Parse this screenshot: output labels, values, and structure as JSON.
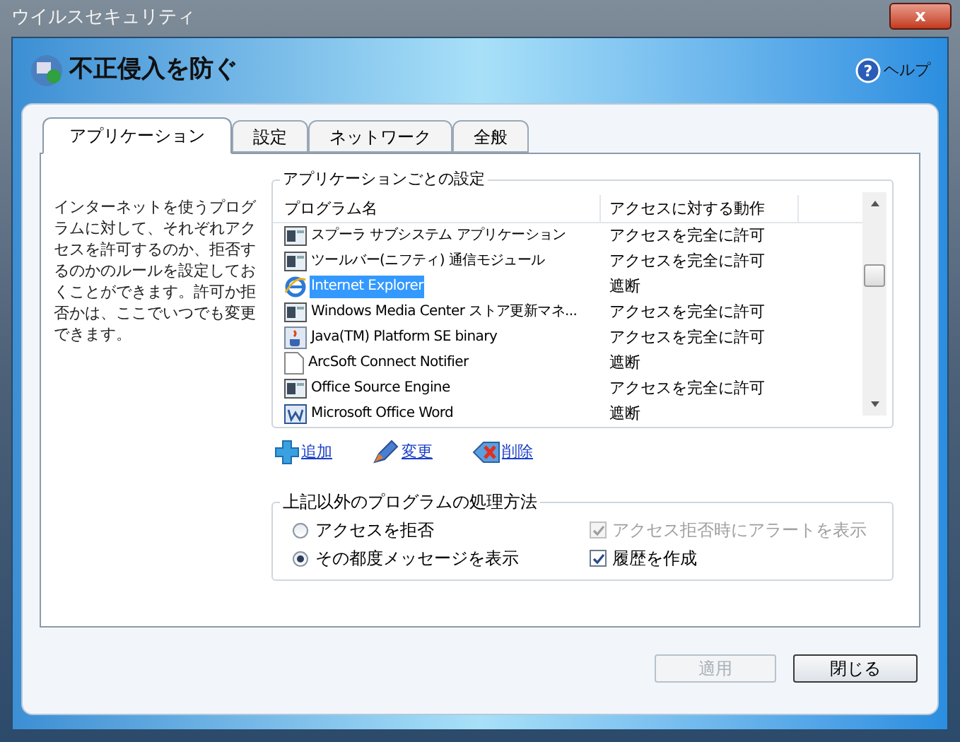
{
  "window": {
    "title": "ウイルスセキュリティ",
    "close": "x"
  },
  "header": {
    "title": "不正侵入を防ぐ",
    "help_icon": "?",
    "help": "ヘルプ"
  },
  "tabs": [
    {
      "label": "アプリケーション",
      "selected": true
    },
    {
      "label": "設定",
      "selected": false
    },
    {
      "label": "ネットワーク",
      "selected": false
    },
    {
      "label": "全般",
      "selected": false
    }
  ],
  "description": "インターネットを使うプログラムに対して、それぞれアクセスを許可するのか、拒否するのかのルールを設定しておくことができます。許可か拒否かは、ここでいつでも変更できます。",
  "app_group": {
    "title": "アプリケーションごとの設定",
    "columns": [
      "プログラム名",
      "アクセスに対する動作"
    ],
    "rows": [
      {
        "kind": "app",
        "name": "スプーラ サブシステム アプリケーション",
        "action": "アクセスを完全に許可",
        "selected": false
      },
      {
        "kind": "app",
        "name": "ツールバー(ニフティ) 通信モジュール",
        "action": "アクセスを完全に許可",
        "selected": false
      },
      {
        "kind": "browser",
        "name": "Internet Explorer",
        "action": "遮断",
        "selected": true
      },
      {
        "kind": "app",
        "name": "Windows Media Center ストア更新マネ...",
        "action": "アクセスを完全に許可",
        "selected": false
      },
      {
        "kind": "java",
        "name": "Java(TM) Platform SE binary",
        "action": "アクセスを完全に許可",
        "selected": false
      },
      {
        "kind": "blank",
        "name": "ArcSoft Connect Notifier",
        "action": "遮断",
        "selected": false
      },
      {
        "kind": "app",
        "name": "Office Source Engine",
        "action": "アクセスを完全に許可",
        "selected": false
      },
      {
        "kind": "word",
        "name": "Microsoft Office Word",
        "action": "遮断",
        "selected": false
      }
    ]
  },
  "links": [
    {
      "kind": "add",
      "label": "追加"
    },
    {
      "kind": "edit",
      "label": "変更"
    },
    {
      "kind": "delete",
      "label": "削除"
    }
  ],
  "other_group": {
    "title": "上記以外のプログラムの処理方法",
    "radios": [
      {
        "label": "アクセスを拒否",
        "selected": false
      },
      {
        "label": "その都度メッセージを表示",
        "selected": true
      }
    ],
    "checkboxes": [
      {
        "label": "アクセス拒否時にアラートを表示",
        "checked": true,
        "disabled": true
      },
      {
        "label": "履歴を作成",
        "checked": true,
        "disabled": false
      }
    ]
  },
  "buttons": [
    {
      "label": "適用",
      "disabled": true
    },
    {
      "label": "閉じる",
      "disabled": false
    }
  ]
}
